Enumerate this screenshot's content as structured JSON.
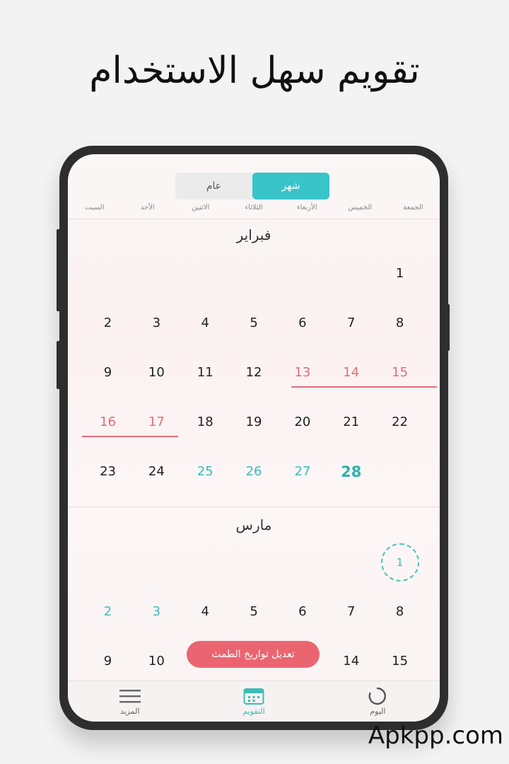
{
  "headline": "تقويم سهل الاستخدام",
  "toggle": {
    "month_label": "شهر",
    "year_label": "عام"
  },
  "weekdays": [
    "الجمعة",
    "الخميس",
    "الأربعاء",
    "الثلاثاء",
    "الاثنين",
    "الأحد",
    "السبت"
  ],
  "months": [
    {
      "title": "فبراير",
      "weeks": [
        [
          "1",
          "",
          "",
          "",
          "",
          "",
          ""
        ],
        [
          "8",
          "7",
          "6",
          "5",
          "4",
          "3",
          "2"
        ],
        [
          "15",
          "14",
          "13",
          "12",
          "11",
          "10",
          "9"
        ],
        [
          "22",
          "21",
          "20",
          "19",
          "18",
          "17",
          "16"
        ],
        [
          "",
          "28",
          "27",
          "26",
          "25",
          "24",
          "23"
        ]
      ]
    },
    {
      "title": "مارس",
      "weeks": [
        [
          "1",
          "",
          "",
          "",
          "",
          "",
          ""
        ],
        [
          "8",
          "7",
          "6",
          "5",
          "4",
          "3",
          "2"
        ],
        [
          "15",
          "14",
          "",
          "",
          "",
          "10",
          "9"
        ]
      ]
    }
  ],
  "edit_button": "تعديل تواريخ الطمث",
  "nav": {
    "today": "اليوم",
    "calendar": "التقويم",
    "more": "المزيد"
  },
  "watermark": "Apkpp.com",
  "colors": {
    "accent": "#39c4c9",
    "period": "#e46b78",
    "fertile": "#3cbcb4"
  }
}
